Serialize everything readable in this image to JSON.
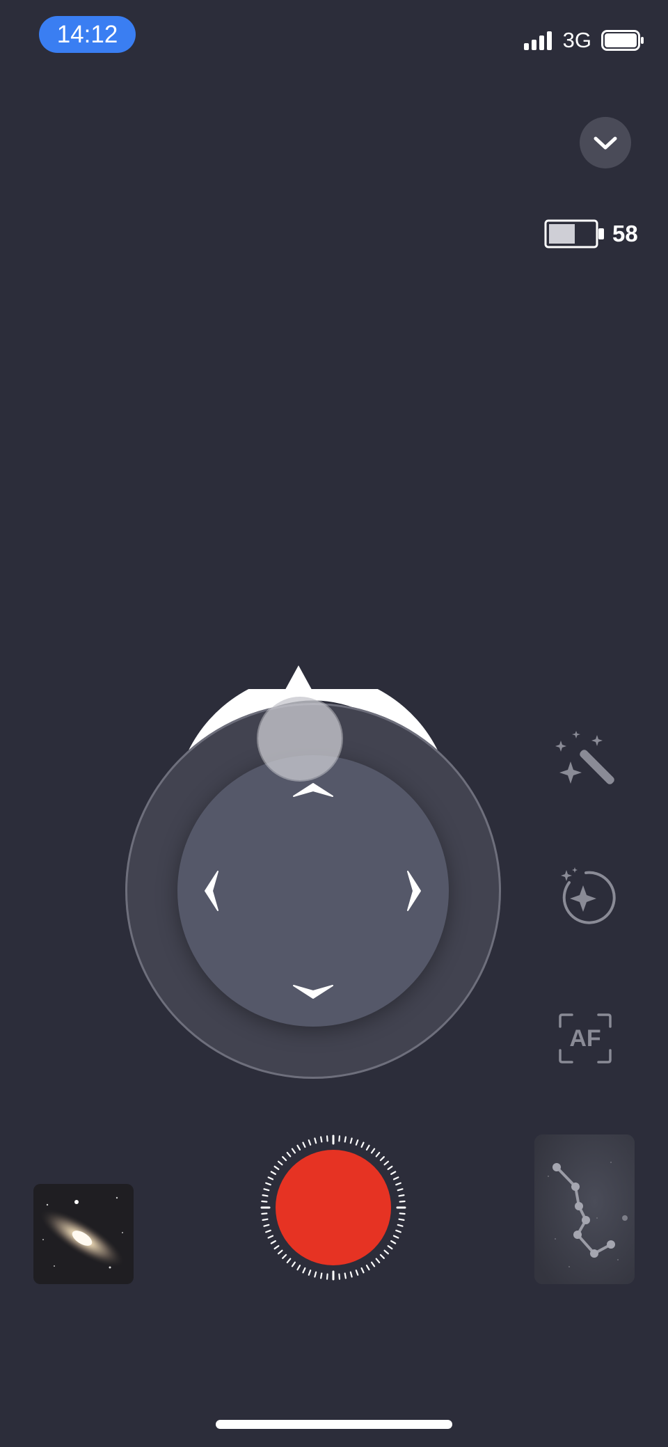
{
  "status_bar": {
    "time": "14:12",
    "network": "3G",
    "signal_icon": "signal-bars-icon",
    "battery_icon": "phone-battery-icon",
    "phone_battery_level": 1.0
  },
  "controls": {
    "collapse_icon": "chevron-down-icon"
  },
  "device_battery": {
    "icon": "battery-icon",
    "value": "58",
    "level": 0.58
  },
  "joystick": {
    "up_icon": "chevron-up-icon",
    "down_icon": "chevron-down-icon",
    "left_icon": "chevron-left-icon",
    "right_icon": "chevron-right-icon",
    "knob": "joystick-knob"
  },
  "tools": [
    {
      "name": "magic-wand-icon"
    },
    {
      "name": "star-focus-icon"
    },
    {
      "name": "autofocus-icon",
      "label": "AF"
    }
  ],
  "bottom": {
    "gallery_icon": "galaxy-thumbnail",
    "shutter_icon": "shutter-button",
    "starmap_icon": "constellation-thumbnail"
  },
  "colors": {
    "background": "#2c2d3a",
    "time_pill": "#3a7ef2",
    "shutter": "#e63323"
  }
}
